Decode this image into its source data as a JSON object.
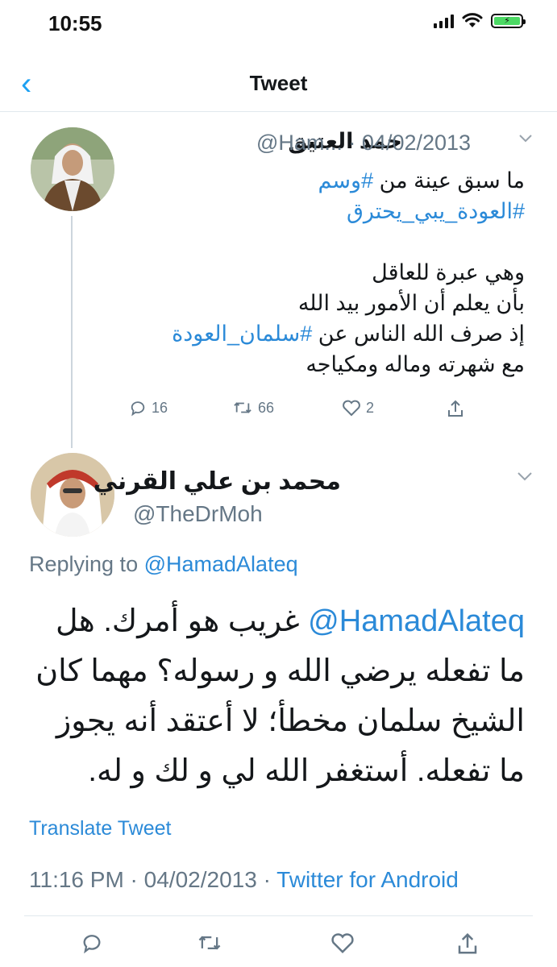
{
  "status_bar": {
    "time": "10:55",
    "battery_icon": "charging-battery-icon"
  },
  "header": {
    "back_icon": "back-chevron-icon",
    "title": "Tweet"
  },
  "tweet1": {
    "name": "حمد العتيق",
    "handle_date": "@Ham... · 04/02/2013",
    "line1": "ما سبق عينة من ",
    "line1_hashtag": "#وسم",
    "line2_hashtag": "#العودة_يبي_يحترق",
    "line3": "وهي عبرة للعاقل",
    "line4": "بأن يعلم أن الأمور بيد الله",
    "line5": "إذ صرف الله الناس عن ",
    "line5_hashtag": "#سلمان_العودة",
    "line6": "مع شهرته وماله ومكياجه",
    "actions": {
      "replies": "16",
      "retweets": "66",
      "likes": "2"
    }
  },
  "tweet2": {
    "name": "محمد بن علي القرني",
    "handle": "@TheDrMoh",
    "replying_prefix": "Replying to ",
    "replying_mention": "@HamadAlateq",
    "body_mention": "@HamadAlateq",
    "body_text": " غريب هو أمرك. هل ما تفعله يرضي الله و رسوله؟ مهما كان الشيخ سلمان مخطأ؛ لا أعتقد أنه يجوز ما تفعله. أستغفر الله لي و لك و له.",
    "translate_label": "Translate Tweet",
    "timestamp": "11:16 PM · 04/02/2013 · ",
    "source": "Twitter for Android"
  },
  "colors": {
    "link": "#2b8ad8",
    "muted": "#657786",
    "text": "#14171a",
    "divider": "#e1e8ed"
  }
}
